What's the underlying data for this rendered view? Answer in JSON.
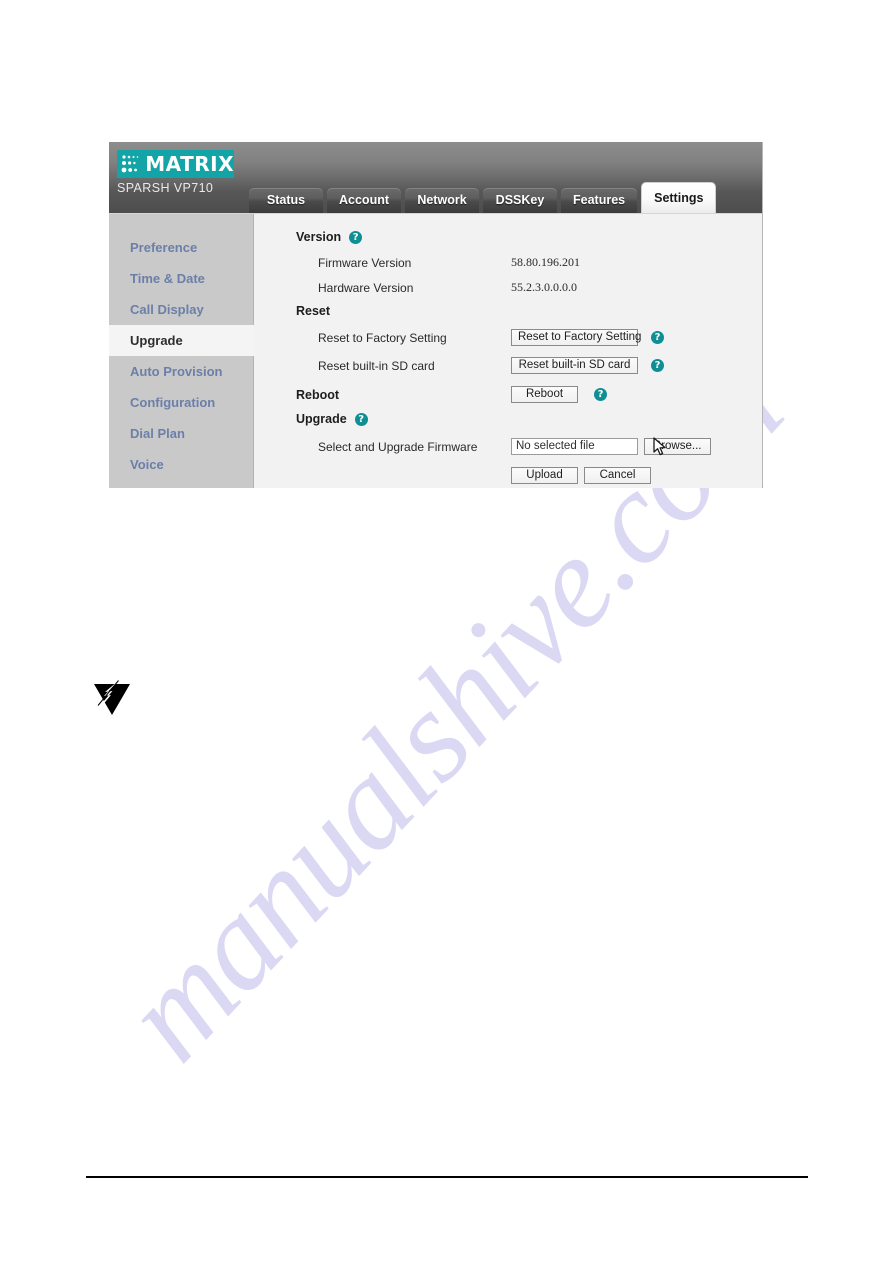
{
  "device_ui": {
    "brand": {
      "logo_icon": "matrix-dots-icon",
      "name": "MATRIX",
      "model": "SPARSH VP710"
    },
    "tabs": [
      {
        "label": "Status",
        "active": false
      },
      {
        "label": "Account",
        "active": false
      },
      {
        "label": "Network",
        "active": false
      },
      {
        "label": "DSSKey",
        "active": false
      },
      {
        "label": "Features",
        "active": false
      },
      {
        "label": "Settings",
        "active": true
      }
    ],
    "sidebar": {
      "items": [
        {
          "label": "Preference",
          "active": false
        },
        {
          "label": "Time & Date",
          "active": false
        },
        {
          "label": "Call Display",
          "active": false
        },
        {
          "label": "Upgrade",
          "active": true
        },
        {
          "label": "Auto Provision",
          "active": false
        },
        {
          "label": "Configuration",
          "active": false
        },
        {
          "label": "Dial Plan",
          "active": false
        },
        {
          "label": "Voice",
          "active": false
        }
      ]
    },
    "content": {
      "version": {
        "title": "Version",
        "help_icon": "help-question-icon",
        "firmware_label": "Firmware Version",
        "firmware_value": "58.80.196.201",
        "hardware_label": "Hardware Version",
        "hardware_value": "55.2.3.0.0.0.0"
      },
      "reset": {
        "title": "Reset",
        "factory_label": "Reset to Factory Setting",
        "factory_button": "Reset to Factory Setting",
        "sdcard_label": "Reset built-in SD card",
        "sdcard_button": "Reset built-in SD card"
      },
      "reboot": {
        "title": "Reboot",
        "button": "Reboot"
      },
      "upgrade": {
        "title": "Upgrade",
        "select_label": "Select and Upgrade Firmware",
        "file_value": "No selected file",
        "browse_button": "Browse...",
        "upload_button": "Upload",
        "cancel_button": "Cancel"
      }
    },
    "help_glyph": "?"
  },
  "page": {
    "watermark_text": "manualshive.com",
    "corner_logo_icon": "lightning-triangle-logo-icon"
  },
  "colors": {
    "brand_teal": "#13a4a8",
    "help_teal": "#0e8f93",
    "sidebar_link": "#6b7fa8",
    "watermark": "#b9b6e8"
  }
}
